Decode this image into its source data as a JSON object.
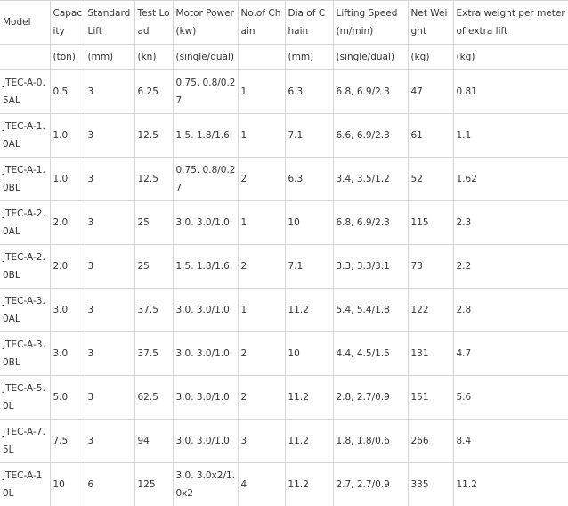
{
  "columns": [
    "Model",
    "Capacity",
    "Standard Lift",
    "Test Load",
    "Motor Power(kw)",
    "No.of Chain",
    "Dia of Chain",
    "Lifting Speed(m/min)",
    "Net Weight",
    "Extra weight per meter of extra lift"
  ],
  "units": [
    "",
    "(ton)",
    "(mm)",
    "(kn)",
    "(single/dual)",
    "",
    "(mm)",
    "(single/dual)",
    "(kg)",
    "(kg)"
  ],
  "rows": [
    [
      "JTEC-A-0.5AL",
      "0.5",
      "3",
      "6.25",
      "0.75. 0.8/0.27",
      "1",
      "6.3",
      "6.8, 6.9/2.3",
      "47",
      "0.81"
    ],
    [
      "JTEC-A-1.0AL",
      "1.0",
      "3",
      "12.5",
      "1.5. 1.8/1.6",
      "1",
      "7.1",
      "6.6, 6.9/2.3",
      "61",
      "1.1"
    ],
    [
      "JTEC-A-1.0BL",
      "1.0",
      "3",
      "12.5",
      "0.75. 0.8/0.27",
      "2",
      "6.3",
      "3.4, 3.5/1.2",
      "52",
      "1.62"
    ],
    [
      "JTEC-A-2.0AL",
      "2.0",
      "3",
      "25",
      "3.0. 3.0/1.0",
      "1",
      "10",
      "6.8, 6.9/2.3",
      "115",
      "2.3"
    ],
    [
      "JTEC-A-2.0BL",
      "2.0",
      "3",
      "25",
      "1.5. 1.8/1.6",
      "2",
      "7.1",
      "3.3, 3.3/3.1",
      "73",
      "2.2"
    ],
    [
      "JTEC-A-3.0AL",
      "3.0",
      "3",
      "37.5",
      "3.0. 3.0/1.0",
      "1",
      "11.2",
      "5.4, 5.4/1.8",
      "122",
      "2.8"
    ],
    [
      "JTEC-A-3.0BL",
      "3.0",
      "3",
      "37.5",
      "3.0. 3.0/1.0",
      "2",
      "10",
      "4.4, 4.5/1.5",
      "131",
      "4.7"
    ],
    [
      "JTEC-A-5.0L",
      "5.0",
      "3",
      "62.5",
      "3.0. 3.0/1.0",
      "2",
      "11.2",
      "2.8, 2.7/0.9",
      "151",
      "5.6"
    ],
    [
      "JTEC-A-7.5L",
      "7.5",
      "3",
      "94",
      "3.0. 3.0/1.0",
      "3",
      "11.2",
      "1.8, 1.8/0.6",
      "266",
      "8.4"
    ],
    [
      "JTEC-A-10L",
      "10",
      "6",
      "125",
      "3.0. 3.0x2/1.0x2",
      "4",
      "11.2",
      "2.7, 2.7/0.9",
      "335",
      "11.2"
    ]
  ]
}
